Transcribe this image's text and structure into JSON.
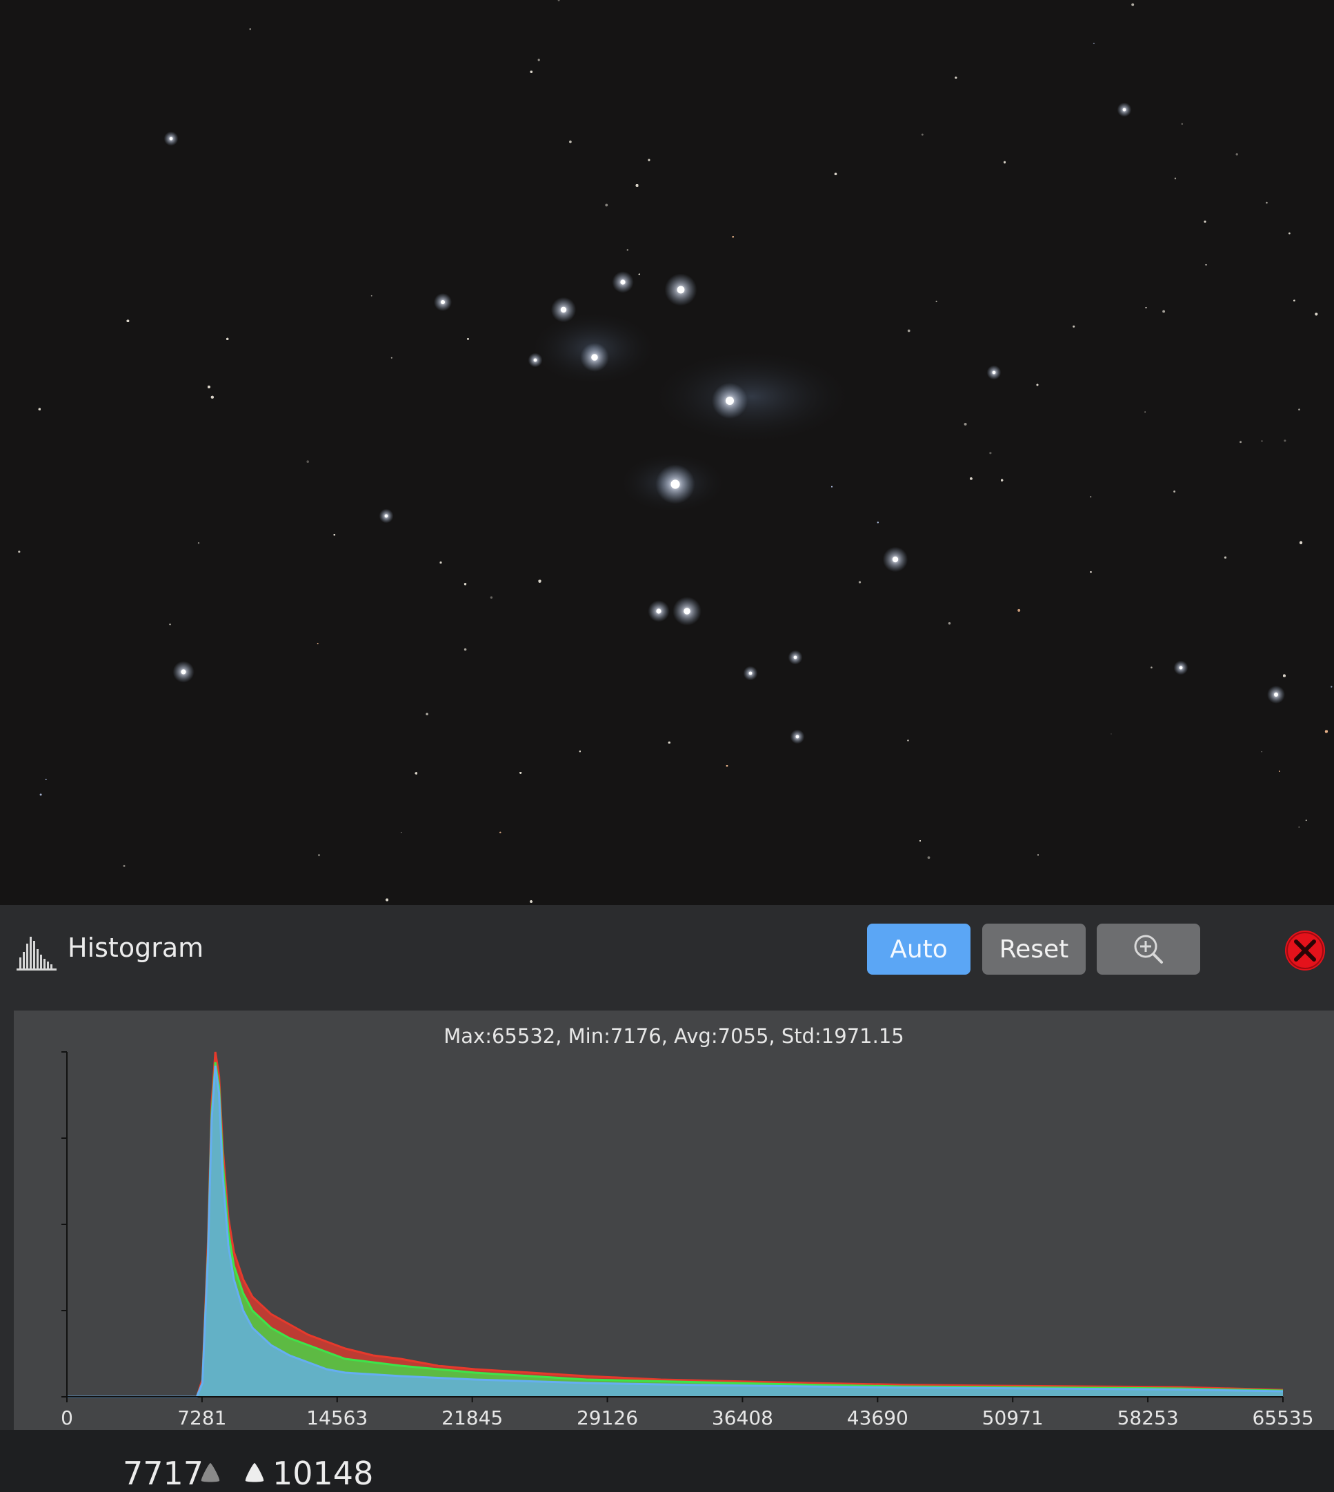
{
  "viewer": {
    "image_name": "star-field-image"
  },
  "histogram_panel": {
    "title": "Histogram",
    "icon": "histogram-icon",
    "buttons": {
      "auto": "Auto",
      "reset": "Reset",
      "zoom_icon": "zoom-in-icon",
      "close_icon": "close-icon"
    },
    "colors": {
      "auto_button": "#5ba6f5",
      "button": "#6d6e70",
      "close": "#e4121b",
      "red_channel": "#e63a2c",
      "green_channel": "#3ee44a",
      "blue_channel": "#66aef2"
    },
    "stats": "Max:65532, Min:7176, Avg:7055, Std:1971.15",
    "stretch": {
      "low": "7717",
      "high": "10148"
    }
  },
  "chart_data": {
    "type": "area",
    "title": "",
    "xlabel": "",
    "ylabel": "",
    "xlim": [
      0,
      65535
    ],
    "ylim": [
      0,
      1
    ],
    "x_ticks": [
      "0",
      "7281",
      "14563",
      "21845",
      "29126",
      "36408",
      "43690",
      "50971",
      "58253",
      "65535"
    ],
    "y_tick_count": 5,
    "grid": false,
    "legend": "none",
    "x": [
      0,
      7000,
      7300,
      7600,
      7800,
      8000,
      8200,
      8400,
      8700,
      9000,
      9500,
      10000,
      11000,
      12000,
      13000,
      14000,
      15000,
      16500,
      18000,
      20000,
      22000,
      25000,
      28000,
      32000,
      36000,
      40000,
      45000,
      50000,
      55000,
      60000,
      65535
    ],
    "series": [
      {
        "name": "R",
        "values": [
          0,
          0,
          0.05,
          0.45,
          0.85,
          1.0,
          0.93,
          0.72,
          0.52,
          0.42,
          0.34,
          0.29,
          0.24,
          0.21,
          0.18,
          0.16,
          0.14,
          0.12,
          0.11,
          0.09,
          0.08,
          0.07,
          0.06,
          0.05,
          0.045,
          0.04,
          0.035,
          0.032,
          0.03,
          0.028,
          0.02
        ]
      },
      {
        "name": "G",
        "values": [
          0,
          0,
          0.04,
          0.42,
          0.82,
          0.97,
          0.9,
          0.68,
          0.48,
          0.38,
          0.3,
          0.25,
          0.2,
          0.17,
          0.15,
          0.13,
          0.11,
          0.1,
          0.09,
          0.08,
          0.07,
          0.06,
          0.05,
          0.045,
          0.04,
          0.035,
          0.03,
          0.028,
          0.026,
          0.024,
          0.018
        ]
      },
      {
        "name": "B",
        "values": [
          0,
          0,
          0.04,
          0.41,
          0.8,
          0.96,
          0.88,
          0.64,
          0.44,
          0.34,
          0.25,
          0.2,
          0.15,
          0.12,
          0.1,
          0.08,
          0.07,
          0.065,
          0.06,
          0.055,
          0.05,
          0.045,
          0.04,
          0.036,
          0.033,
          0.03,
          0.027,
          0.025,
          0.023,
          0.021,
          0.016
        ]
      }
    ]
  }
}
